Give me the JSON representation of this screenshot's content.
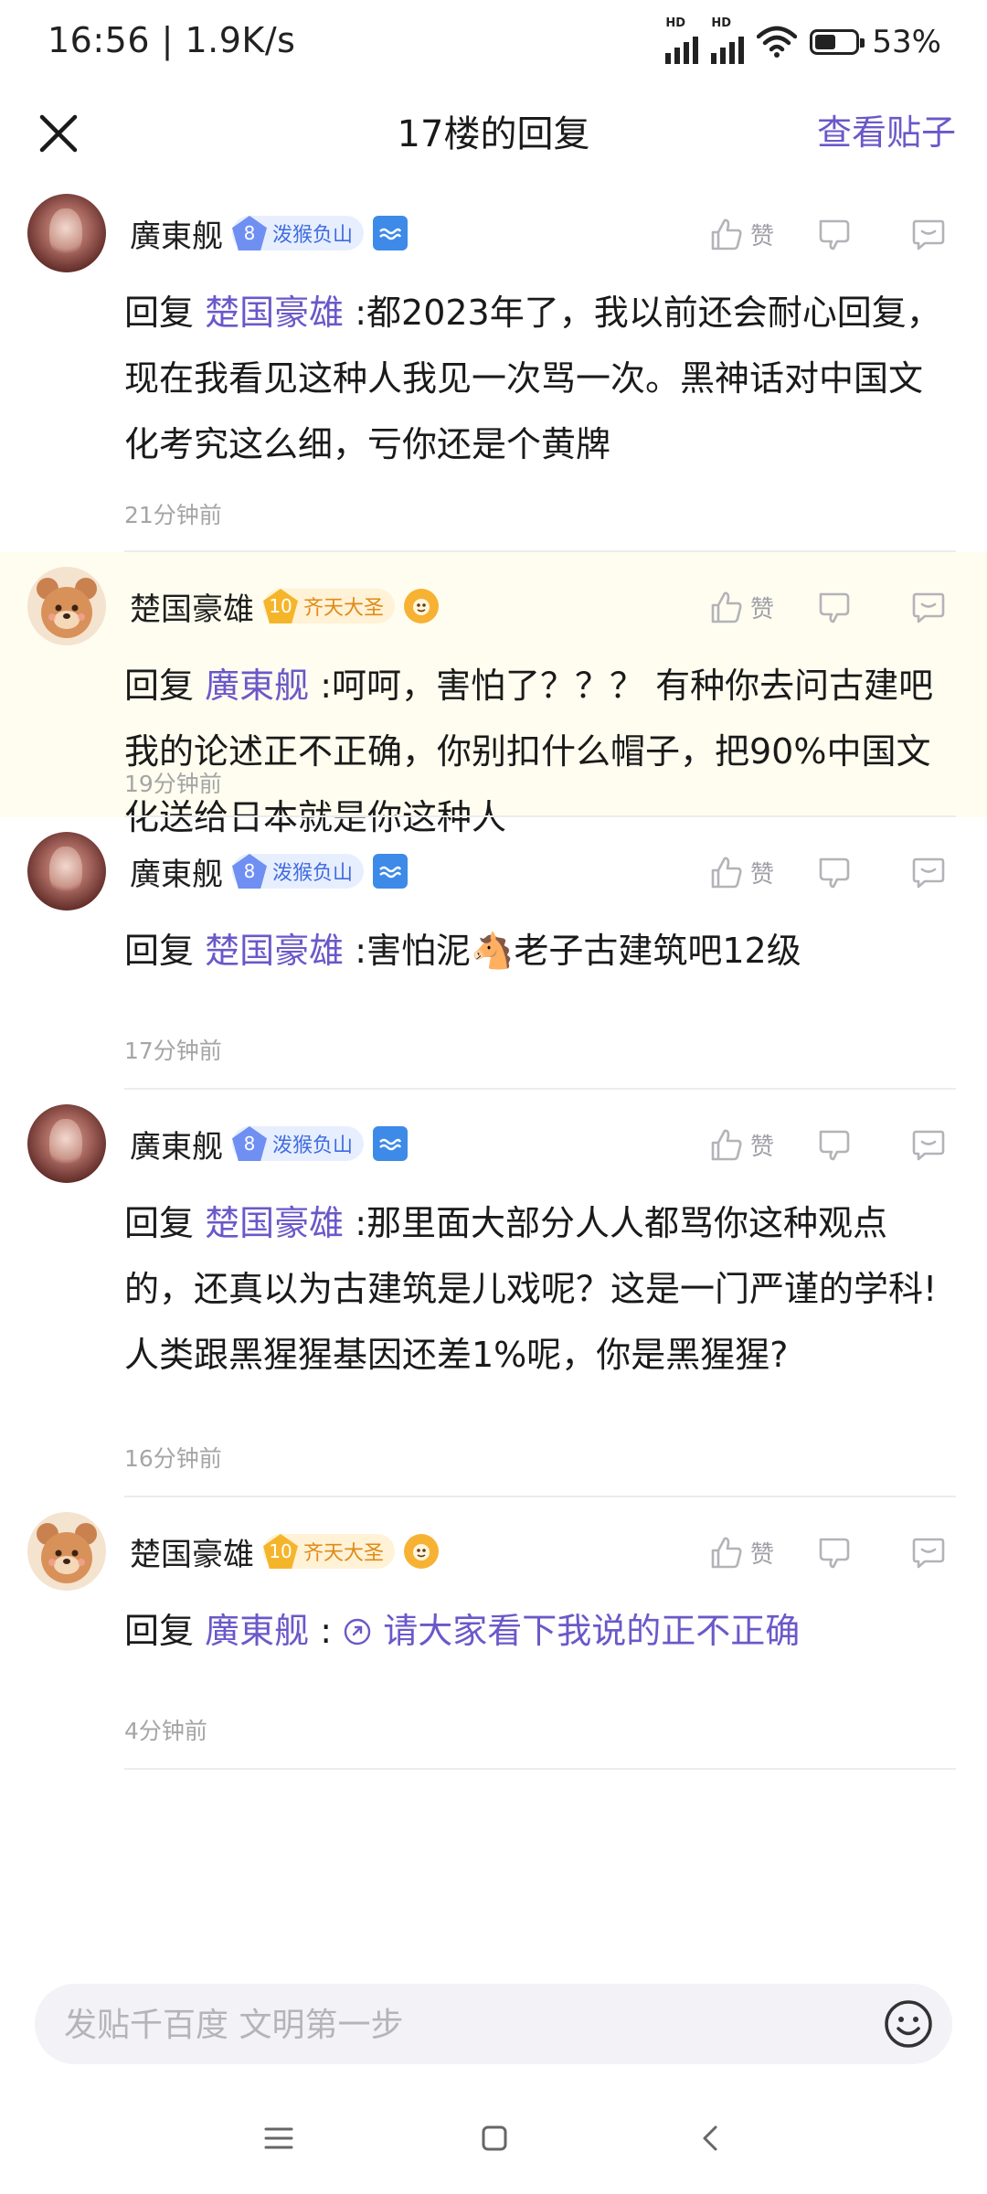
{
  "status_bar": {
    "time_speed": "16:56 | 1.9K/s",
    "battery_pct": "53%",
    "battery_level": 0.53,
    "hd_label": "HD"
  },
  "header": {
    "title": "17楼的回复",
    "right_link": "查看贴子",
    "close_icon": "close-icon"
  },
  "colors": {
    "accent": "#6b58c9",
    "highlight_bg": "#fefdf0",
    "muted": "#a5a5a5"
  },
  "posts": [
    {
      "user": "廣東舰",
      "level": "8",
      "badge": "泼猴负山",
      "badge_color": "blue",
      "like_label": "赞",
      "reply_prefix": "回复",
      "reply_to": "楚国豪雄",
      "text": ":都2023年了，我以前还会耐心回复，现在我看见这种人我见一次骂一次。黑神话对中国文化考究这么细，亏你还是个黄牌",
      "time": "21分钟前"
    },
    {
      "user": "楚国豪雄",
      "level": "10",
      "badge": "齐天大圣",
      "badge_color": "gold",
      "like_label": "赞",
      "reply_prefix": "回复",
      "reply_to": "廣東舰",
      "text": ":呵呵，害怕了？？？ 有种你去问古建吧我的论述正不正确，你别扣什么帽子，把90%中国文化送给日本就是你这种人",
      "time": "19分钟前"
    },
    {
      "user": "廣東舰",
      "level": "8",
      "badge": "泼猴负山",
      "badge_color": "blue",
      "like_label": "赞",
      "reply_prefix": "回复",
      "reply_to": "楚国豪雄",
      "text": ":害怕泥🐴老子古建筑吧12级",
      "time": "17分钟前"
    },
    {
      "user": "廣東舰",
      "level": "8",
      "badge": "泼猴负山",
      "badge_color": "blue",
      "like_label": "赞",
      "reply_prefix": "回复",
      "reply_to": "楚国豪雄",
      "text": ":那里面大部分人人都骂你这种观点的，还真以为古建筑是儿戏呢？这是一门严谨的学科!人类跟黑猩猩基因还差1%呢，你是黑猩猩?",
      "time": "16分钟前"
    },
    {
      "user": "楚国豪雄",
      "level": "10",
      "badge": "齐天大圣",
      "badge_color": "gold",
      "like_label": "赞",
      "reply_prefix": "回复",
      "reply_to": "廣東舰",
      "text": ":",
      "link_text": "请大家看下我说的正不正确",
      "time": "4分钟前"
    }
  ],
  "composer": {
    "placeholder": "发贴千百度 文明第一步"
  }
}
